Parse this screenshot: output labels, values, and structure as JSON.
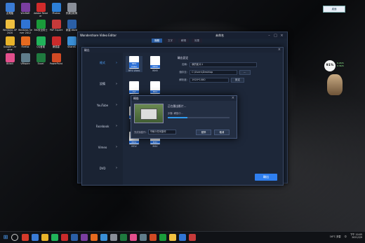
{
  "desktop": {
    "icons": [
      {
        "label": "此電腦",
        "color": "#3a7bd5"
      },
      {
        "label": "WinRAR",
        "color": "#7a3ea0"
      },
      {
        "label": "Adobe Reader",
        "color": "#d12b2b"
      },
      {
        "label": "Photos",
        "color": "#2d7fd6"
      },
      {
        "label": "資源回收筒",
        "color": "#8a8f99"
      },
      {
        "label": "Windows XP 2020",
        "color": "#f0c040"
      },
      {
        "label": "Windows Server 2012",
        "color": "#3074d3"
      },
      {
        "label": "360安全衛士",
        "color": "#1a9b3a"
      },
      {
        "label": "PDF Expert",
        "color": "#c63a3a"
      },
      {
        "label": "新建 Word",
        "color": "#2b5fa6"
      },
      {
        "label": "Google Chrome",
        "color": "#e8b32a"
      },
      {
        "label": "Firefox",
        "color": "#e66a1f"
      },
      {
        "label": "QQ音樂",
        "color": "#21b35a"
      },
      {
        "label": "網易雲",
        "color": "#c92b2b"
      },
      {
        "label": "ShareX",
        "color": "#3a8fd6"
      },
      {
        "label": "Bilibili",
        "color": "#e34f8c"
      },
      {
        "label": "VMware",
        "color": "#607d8b"
      },
      {
        "label": "Excel",
        "color": "#1f7a3f"
      },
      {
        "label": "PowerPoint",
        "color": "#d14a24"
      }
    ],
    "top_right_label": "桌面"
  },
  "video_editor": {
    "title": "Wondershare Video Editor",
    "filename": "未命名",
    "tabs": [
      "媒體",
      "文字",
      "轉場",
      "效果"
    ],
    "active_tab": 0
  },
  "export_dialog": {
    "title": "輸出",
    "close": "×",
    "sidebar": [
      {
        "label": "格式",
        "active": true
      },
      {
        "label": "設備",
        "active": false
      },
      {
        "label": "YouTube",
        "active": false
      },
      {
        "label": "Facebook",
        "active": false
      },
      {
        "label": "Vimeo",
        "active": false
      },
      {
        "label": "DVD",
        "active": false
      }
    ],
    "formats": [
      "MP4 Video",
      "WMV",
      "AVI",
      "MKV",
      "HTML5",
      "GIF",
      "MOV",
      "M4V"
    ],
    "settings": {
      "heading": "輸出設定",
      "name_label": "名稱:",
      "name_value": "我的影片1",
      "path_label": "儲存至:",
      "path_value": "C:\\Users\\Desktop",
      "res_label": "解析度:",
      "res_value": "1920*1080",
      "settings_button": "設定"
    },
    "export_button": "輸出"
  },
  "progress_dialog": {
    "title": "轉換",
    "close": "×",
    "status": "正在匯出影片...",
    "step": "步驟: 轉換中...",
    "progress": 0.32,
    "after_label": "完成後動作:",
    "after_value": "不執行任何動作",
    "pause_button": "暫停",
    "cancel_button": "取消"
  },
  "tray_widget": {
    "percent": "91%",
    "line1": "0.2K/S",
    "line2": "0.3K/S"
  },
  "taskbar": {
    "start": "⊞",
    "items": [
      "#d43a2a",
      "#3a7bd5",
      "#e8b32a",
      "#21b35a",
      "#c92b2b",
      "#2b5fa6",
      "#7a3ea0",
      "#e66a1f",
      "#3a8fd6",
      "#8a8f99",
      "#1f7a3f",
      "#e34f8c",
      "#607d8b",
      "#d14a24",
      "#1a9b3a",
      "#f0c040",
      "#3074d3",
      "#c63a3a"
    ],
    "weather": "16°C 多雲",
    "lang": "中",
    "time": "下午 10:05",
    "date": "2021/2/9"
  }
}
